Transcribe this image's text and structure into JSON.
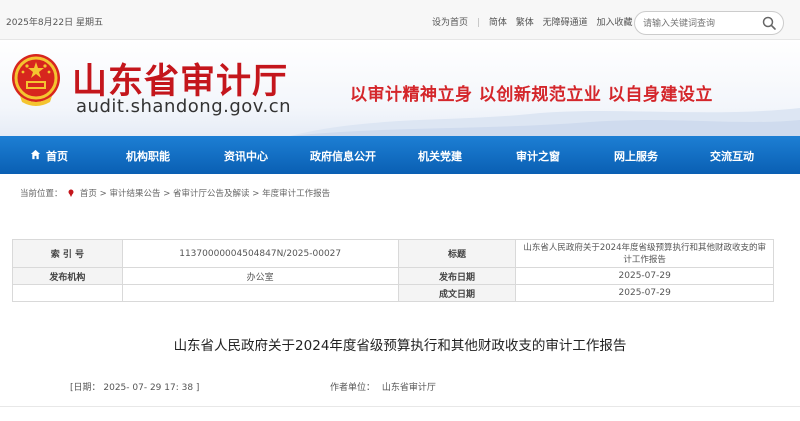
{
  "topbar": {
    "date": "2025年8月22日 星期五",
    "links": [
      "设为首页",
      "简体",
      "繁体",
      "无障碍通道",
      "加入收藏"
    ],
    "search_placeholder": "请输入关键词查询"
  },
  "banner": {
    "site_name": "山东省审计厅",
    "domain": "audit.shandong.gov.cn",
    "slogan": "以审计精神立身 以创新规范立业 以自身建设立"
  },
  "nav": {
    "items": [
      "首页",
      "机构职能",
      "资讯中心",
      "政府信息公开",
      "机关党建",
      "审计之窗",
      "网上服务",
      "交流互动"
    ]
  },
  "breadcrumb": {
    "prefix": "当前位置：",
    "items": [
      "首页",
      "审计结果公告",
      "省审计厅公告及解读",
      "年度审计工作报告"
    ],
    "separator": ">"
  },
  "info_table": {
    "index_label": "索 引 号",
    "index_value": "11370000004504847N/2025-00027",
    "title_label": "标题",
    "title_value": "山东省人民政府关于2024年度省级预算执行和其他财政收支的审计工作报告",
    "publisher_label": "发布机构",
    "publisher_value": "办公室",
    "publish_date_label": "发布日期",
    "publish_date_value": "2025-07-29",
    "created_date_label": "成文日期",
    "created_date_value": "2025-07-29"
  },
  "article": {
    "title": "山东省人民政府关于2024年度省级预算执行和其他财政收支的审计工作报告",
    "date_text": "[日期： 2025- 07- 29 17: 38 ]",
    "author_label": "作者单位：",
    "author_value": "山东省审计厅"
  },
  "colors": {
    "brand_red": "#c4161c",
    "nav_blue": "#0a5fb3"
  }
}
